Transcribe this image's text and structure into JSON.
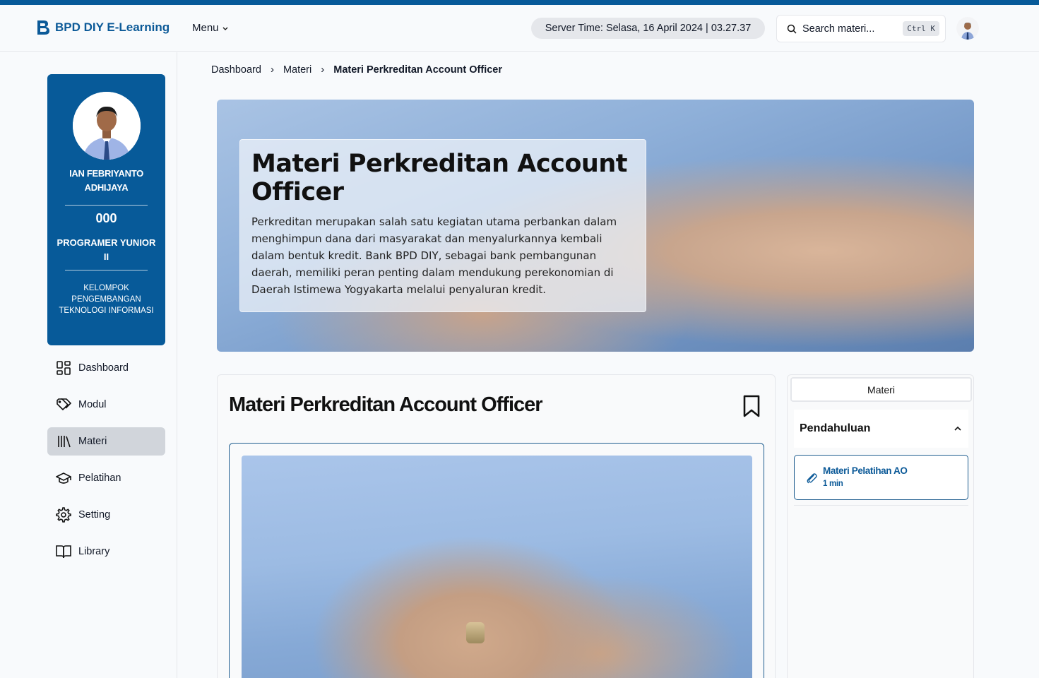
{
  "app": {
    "brand": "BPD DIY E-Learning",
    "menu_label": "Menu"
  },
  "header": {
    "server_time": "Server Time: Selasa, 16 April 2024 | 03.27.37",
    "search_placeholder": "Search materi...",
    "search_shortcut": "Ctrl K"
  },
  "profile": {
    "name": "IAN FEBRIYANTO ADHIJAYA",
    "id": "000",
    "role": "PROGRAMER YUNIOR II",
    "group": "KELOMPOK PENGEMBANGAN TEKNOLOGI INFORMASI"
  },
  "nav": {
    "items": [
      {
        "label": "Dashboard",
        "icon": "dashboard-icon"
      },
      {
        "label": "Modul",
        "icon": "tag-icon"
      },
      {
        "label": "Materi",
        "icon": "library-icon",
        "active": true
      },
      {
        "label": "Pelatihan",
        "icon": "graduation-cap-icon"
      },
      {
        "label": "Setting",
        "icon": "gear-icon"
      },
      {
        "label": "Library",
        "icon": "book-open-icon"
      }
    ]
  },
  "breadcrumb": [
    "Dashboard",
    "Materi",
    "Materi Perkreditan Account Officer"
  ],
  "hero": {
    "title": "Materi Perkreditan Account Officer",
    "description": "Perkreditan merupakan salah satu kegiatan utama perbankan dalam menghimpun dana dari masyarakat dan menyalurkannya kembali dalam bentuk kredit. Bank BPD DIY, sebagai bank pembangunan daerah, memiliki peran penting dalam mendukung perekonomian di Daerah Istimewa Yogyakarta melalui penyaluran kredit."
  },
  "content": {
    "title": "Materi Perkreditan Account Officer"
  },
  "side_panel": {
    "tab": "Materi",
    "section": "Pendahuluan",
    "lessons": [
      {
        "title": "Materi Pelatihan AO",
        "duration": "1 min"
      }
    ]
  },
  "colors": {
    "primary": "#075a99",
    "accent": "#0c5a98",
    "active_nav": "#d1d5db"
  }
}
